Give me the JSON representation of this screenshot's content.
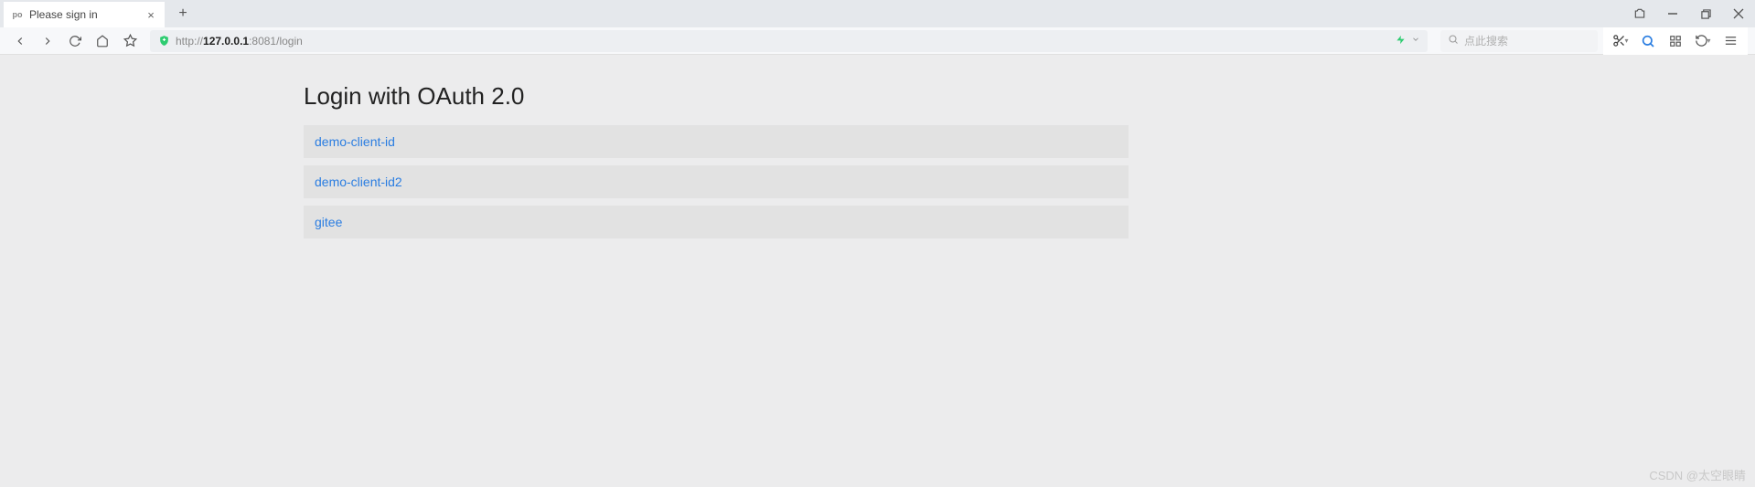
{
  "tab": {
    "title": "Please sign in",
    "favicon": "po"
  },
  "url": {
    "protocol": "http://",
    "host": "127.0.0.1",
    "port_path": ":8081/login"
  },
  "search": {
    "placeholder": "点此搜索"
  },
  "page": {
    "heading": "Login with OAuth 2.0",
    "providers": [
      {
        "label": "demo-client-id"
      },
      {
        "label": "demo-client-id2"
      },
      {
        "label": "gitee"
      }
    ]
  },
  "watermark": "CSDN @太空眼睛"
}
